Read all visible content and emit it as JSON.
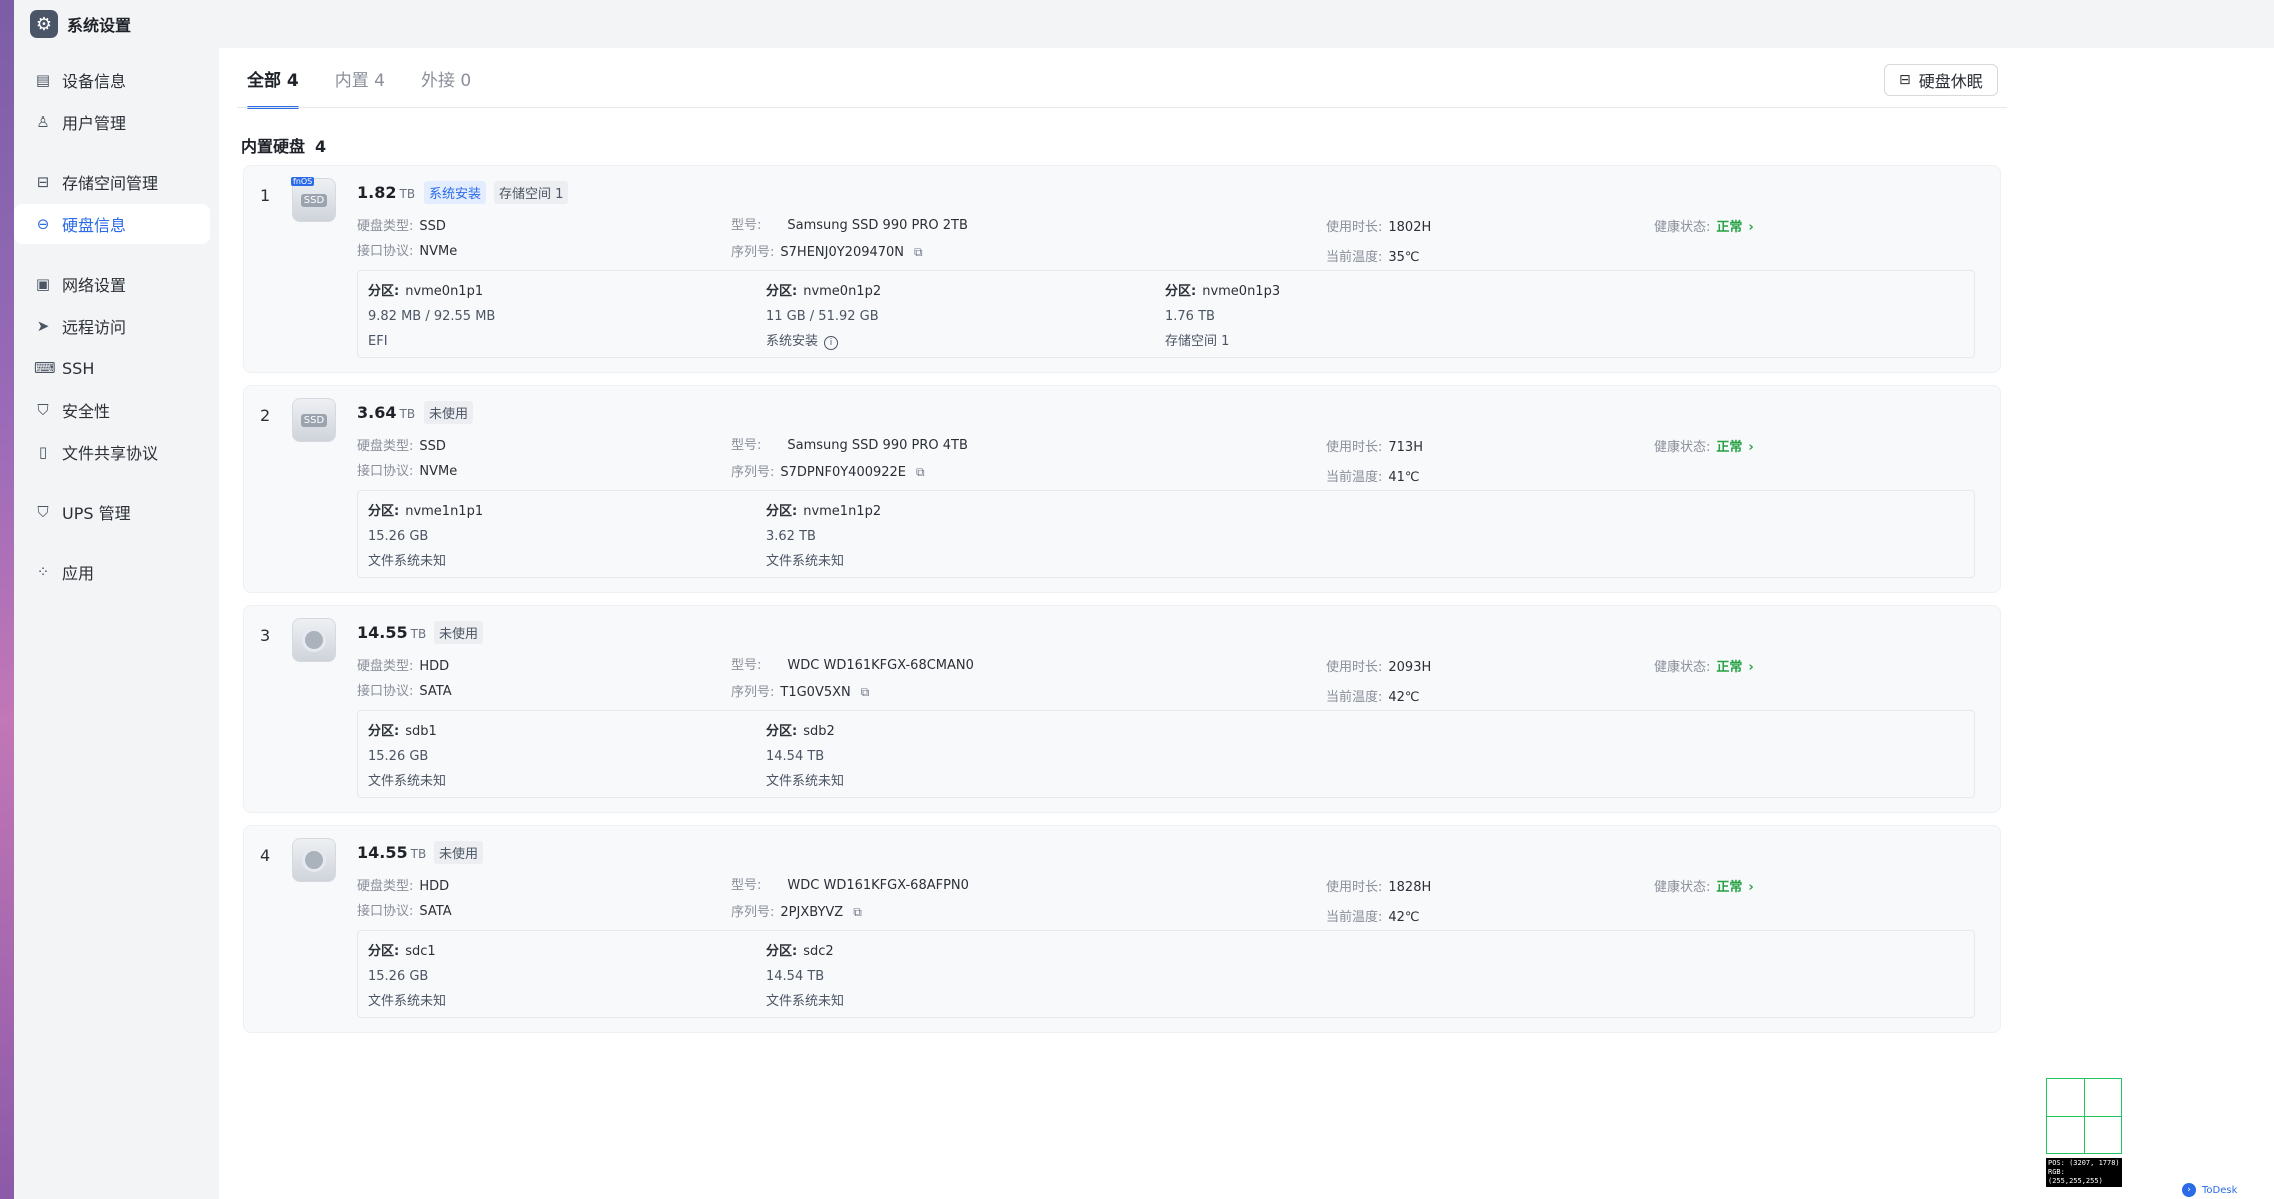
{
  "app": {
    "title": "系统设置"
  },
  "nav": [
    {
      "label": "设备信息",
      "icon": "device-info-icon"
    },
    {
      "label": "用户管理",
      "icon": "user-icon"
    },
    {
      "label": "存储空间管理",
      "icon": "storage-icon"
    },
    {
      "label": "硬盘信息",
      "icon": "disk-icon",
      "active": true
    },
    {
      "label": "网络设置",
      "icon": "network-icon"
    },
    {
      "label": "远程访问",
      "icon": "send-icon"
    },
    {
      "label": "SSH",
      "icon": "terminal-icon"
    },
    {
      "label": "安全性",
      "icon": "shield-icon"
    },
    {
      "label": "文件共享协议",
      "icon": "file-icon"
    },
    {
      "label": "UPS 管理",
      "icon": "ups-shield-icon"
    },
    {
      "label": "应用",
      "icon": "apps-icon"
    }
  ],
  "tabs": [
    {
      "label": "全部 4",
      "active": true
    },
    {
      "label": "内置 4"
    },
    {
      "label": "外接 0"
    }
  ],
  "sleep_button": "硬盘休眠",
  "section": {
    "title": "内置硬盘",
    "count": "4"
  },
  "labels": {
    "type": "硬盘类型:",
    "protocol": "接口协议:",
    "model": "型号:",
    "serial": "序列号:",
    "usage": "使用时长:",
    "temp": "当前温度:",
    "health": "健康状态:",
    "partition": "分区:"
  },
  "disks": [
    {
      "index": "1",
      "size": "1.82",
      "unit": "TB",
      "kind": "ssd",
      "tags": [
        "系统安装",
        "存储空间 1"
      ],
      "type": "SSD",
      "protocol": "NVMe",
      "model": "Samsung SSD 990 PRO 2TB",
      "serial": "S7HENJ0Y209470N",
      "usage": "1802H",
      "temp": "35℃",
      "health": "正常",
      "partitions": [
        {
          "name": "nvme0n1p1",
          "size": "9.82 MB / 92.55 MB",
          "fs": "EFI"
        },
        {
          "name": "nvme0n1p2",
          "size": "11 GB / 51.92 GB",
          "fs": "系统安装"
        },
        {
          "name": "nvme0n1p3",
          "size": "1.76 TB",
          "fs": "存储空间 1"
        }
      ]
    },
    {
      "index": "2",
      "size": "3.64",
      "unit": "TB",
      "kind": "ssd",
      "tags": [
        "未使用"
      ],
      "type": "SSD",
      "protocol": "NVMe",
      "model": "Samsung SSD 990 PRO 4TB",
      "serial": "S7DPNF0Y400922E",
      "usage": "713H",
      "temp": "41℃",
      "health": "正常",
      "partitions": [
        {
          "name": "nvme1n1p1",
          "size": "15.26 GB",
          "fs": "文件系统未知"
        },
        {
          "name": "nvme1n1p2",
          "size": "3.62 TB",
          "fs": "文件系统未知"
        }
      ]
    },
    {
      "index": "3",
      "size": "14.55",
      "unit": "TB",
      "kind": "hdd",
      "tags": [
        "未使用"
      ],
      "type": "HDD",
      "protocol": "SATA",
      "model": "WDC WD161KFGX-68CMAN0",
      "serial": "T1G0V5XN",
      "usage": "2093H",
      "temp": "42℃",
      "health": "正常",
      "partitions": [
        {
          "name": "sdb1",
          "size": "15.26 GB",
          "fs": "文件系统未知"
        },
        {
          "name": "sdb2",
          "size": "14.54 TB",
          "fs": "文件系统未知"
        }
      ]
    },
    {
      "index": "4",
      "size": "14.55",
      "unit": "TB",
      "kind": "hdd",
      "tags": [
        "未使用"
      ],
      "type": "HDD",
      "protocol": "SATA",
      "model": "WDC WD161KFGX-68AFPN0",
      "serial": "2PJXBYVZ",
      "usage": "1828H",
      "temp": "42℃",
      "health": "正常",
      "partitions": [
        {
          "name": "sdc1",
          "size": "15.26 GB",
          "fs": "文件系统未知"
        },
        {
          "name": "sdc2",
          "size": "14.54 TB",
          "fs": "文件系统未知"
        }
      ]
    }
  ],
  "overlay": {
    "pos": "POS: (3207, 1778)",
    "rgb": "RGB: (255,255,255)",
    "todesk": "ToDesk"
  },
  "colors": {
    "accent": "#2b6be6",
    "health_ok": "#27a244"
  }
}
